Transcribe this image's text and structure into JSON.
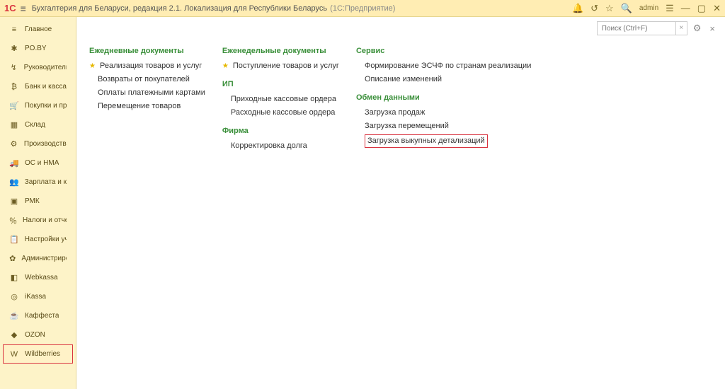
{
  "titlebar": {
    "logo": "1С",
    "title": "Бухгалтерия для Беларуси, редакция 2.1. Локализация для Республики Беларусь",
    "title_ext": "(1С:Предприятие)",
    "user": "admin"
  },
  "search": {
    "placeholder": "Поиск (Ctrl+F)"
  },
  "sidebar": [
    {
      "icon": "≡",
      "label": "Главное"
    },
    {
      "icon": "✱",
      "label": "PO.BY"
    },
    {
      "icon": "↯",
      "label": "Руководителю"
    },
    {
      "icon": "₿",
      "label": "Банк и касса"
    },
    {
      "icon": "🛒",
      "label": "Покупки и продажи"
    },
    {
      "icon": "▦",
      "label": "Склад"
    },
    {
      "icon": "⚙",
      "label": "Производство"
    },
    {
      "icon": "🚚",
      "label": "ОС и НМА"
    },
    {
      "icon": "👥",
      "label": "Зарплата и кадры"
    },
    {
      "icon": "▣",
      "label": "РМК"
    },
    {
      "icon": "％",
      "label": "Налоги и отчетность"
    },
    {
      "icon": "📋",
      "label": "Настройки учета"
    },
    {
      "icon": "✿",
      "label": "Администрирование"
    },
    {
      "icon": "◧",
      "label": "Webkassa"
    },
    {
      "icon": "◎",
      "label": "iKassa"
    },
    {
      "icon": "☕",
      "label": "Каффеста"
    },
    {
      "icon": "◆",
      "label": "OZON"
    },
    {
      "icon": "W",
      "label": "Wildberries"
    }
  ],
  "sidebar_selected": 17,
  "columns": [
    {
      "sections": [
        {
          "title": "Ежедневные документы",
          "items": [
            {
              "text": "Реализация товаров и услуг",
              "starred": true
            },
            {
              "text": "Возвраты от покупателей"
            },
            {
              "text": "Оплаты платежными картами"
            },
            {
              "text": "Перемещение товаров"
            }
          ]
        }
      ]
    },
    {
      "sections": [
        {
          "title": "Еженедельные документы",
          "items": [
            {
              "text": "Поступление товаров и услуг",
              "starred": true
            }
          ]
        },
        {
          "title": "ИП",
          "items": [
            {
              "text": "Приходные кассовые ордера"
            },
            {
              "text": "Расходные кассовые ордера"
            }
          ]
        },
        {
          "title": "Фирма",
          "items": [
            {
              "text": "Корректировка долга"
            }
          ]
        }
      ]
    },
    {
      "sections": [
        {
          "title": "Сервис",
          "items": [
            {
              "text": "Формирование ЭСЧФ по странам реализации"
            },
            {
              "text": "Описание изменений"
            }
          ]
        },
        {
          "title": "Обмен данными",
          "items": [
            {
              "text": "Загрузка продаж"
            },
            {
              "text": "Загрузка перемещений"
            },
            {
              "text": "Загрузка выкупных детализаций",
              "highlight": true
            }
          ]
        }
      ]
    }
  ]
}
